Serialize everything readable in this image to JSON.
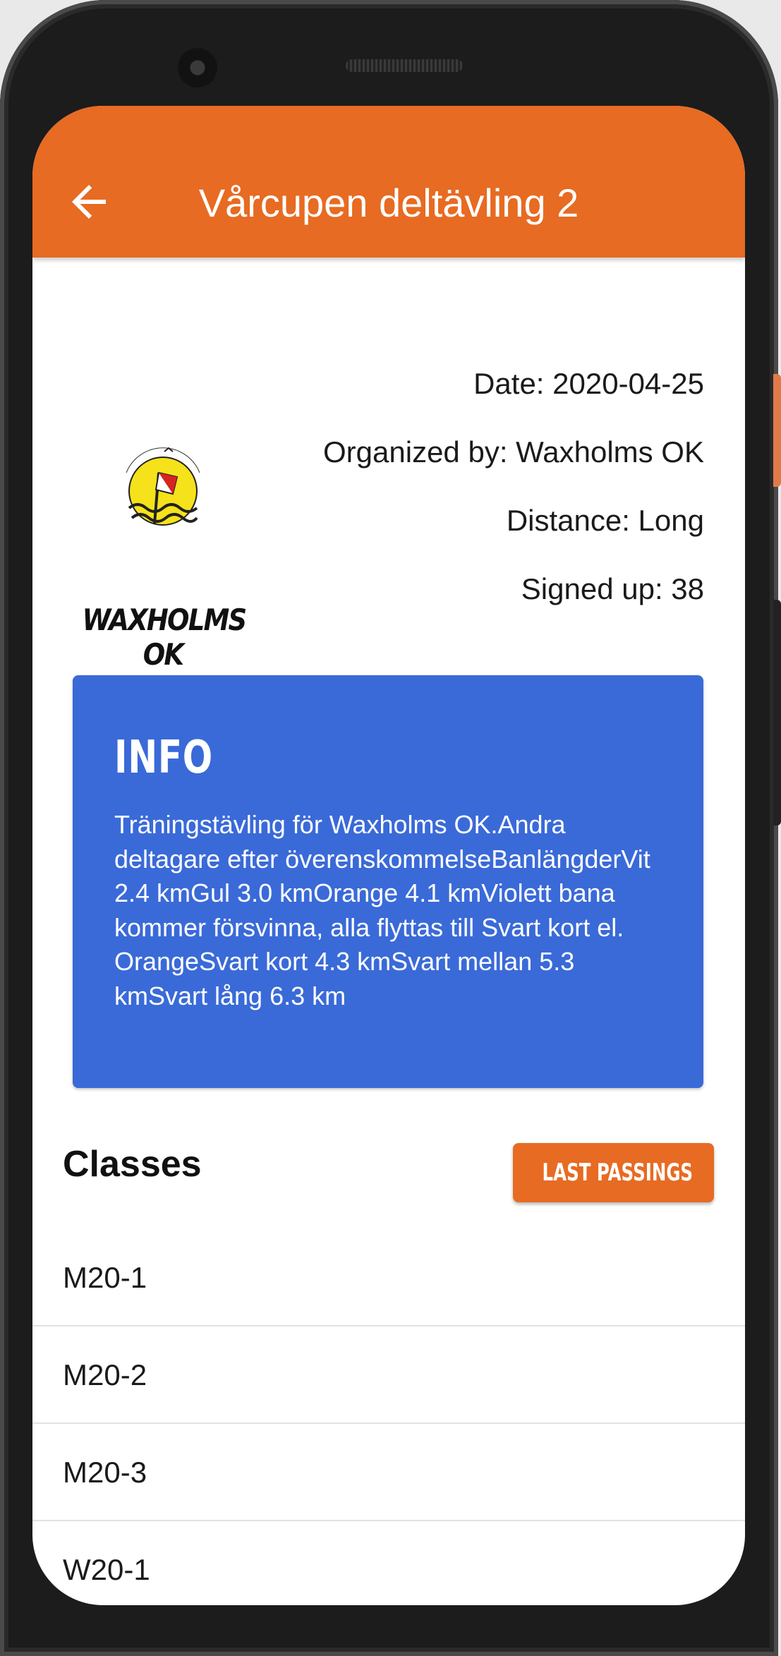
{
  "appbar": {
    "title": "Vårcupen deltävling 2",
    "back_icon": "arrow-back-icon",
    "color": "#e76b22"
  },
  "club_logo": {
    "text": "WAXHOLMS OK",
    "emblem_text": "WAXHOLMS OK"
  },
  "details": {
    "date": "Date: 2020-04-25",
    "organizer": "Organized by: Waxholms OK",
    "distance": "Distance: Long",
    "signed_up": "Signed up: 38"
  },
  "info": {
    "title": "INFO",
    "text": "Träningstävling för Waxholms OK.Andra deltagare efter överenskommelseBanlängderVit 2.4 kmGul 3.0 kmOrange 4.1 kmViolett bana kommer försvinna, alla flyttas till Svart kort el. OrangeSvart kort 4.3 kmSvart mellan 5.3 kmSvart lång 6.3 km",
    "color": "#3a6ad8"
  },
  "classes": {
    "heading": "Classes",
    "last_passings_label": "LAST PASSINGS",
    "items": [
      "M20-1",
      "M20-2",
      "M20-3",
      "W20-1"
    ]
  }
}
